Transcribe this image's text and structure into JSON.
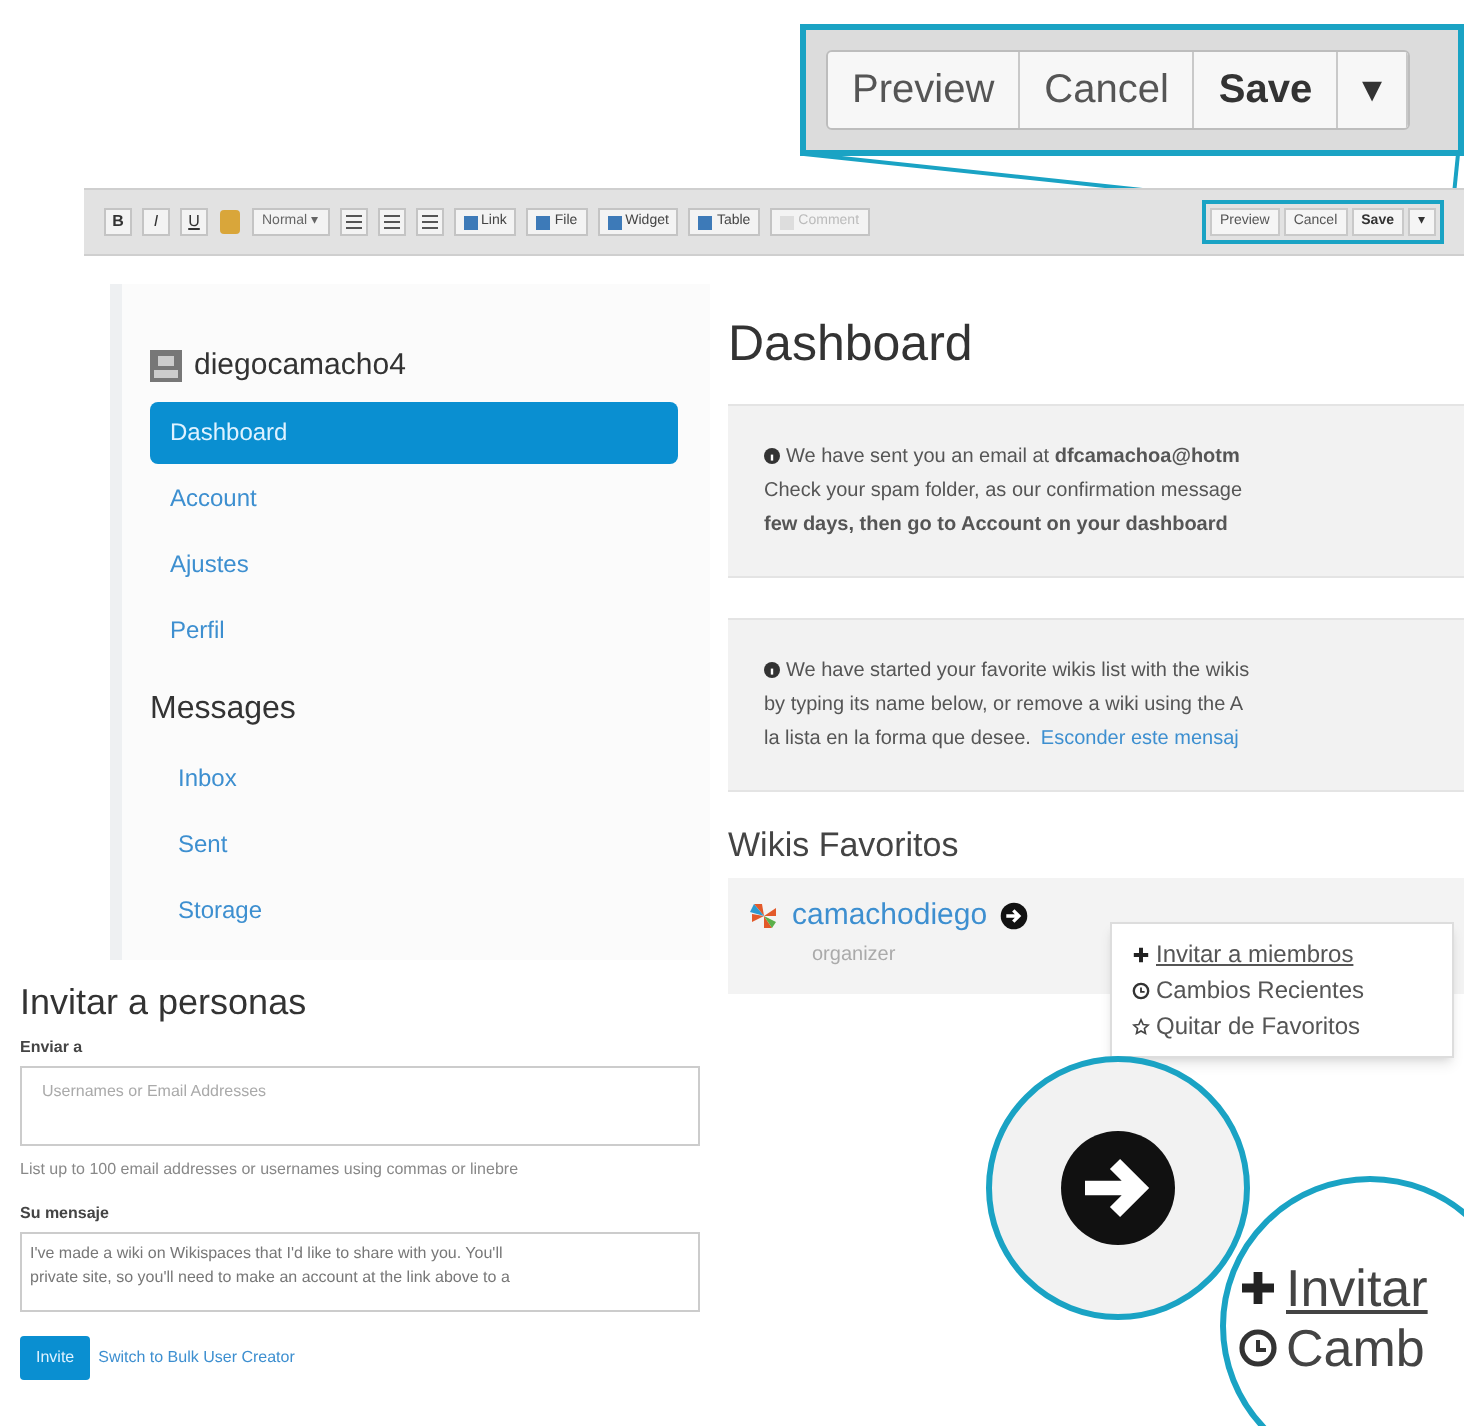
{
  "callout_buttons": [
    {
      "label": "Preview",
      "kind": "button"
    },
    {
      "label": "Cancel",
      "kind": "button"
    },
    {
      "label": "Save",
      "kind": "primary"
    },
    {
      "label": "▾",
      "kind": "caret"
    }
  ],
  "toolbar": {
    "format_buttons": [
      "B",
      "I",
      "U"
    ],
    "style_select": "Normal",
    "style_caret": "▾",
    "tools": [
      {
        "label": "Link",
        "disabled": false
      },
      {
        "label": "File",
        "disabled": false
      },
      {
        "label": "Widget",
        "disabled": false
      },
      {
        "label": "Table",
        "disabled": false
      },
      {
        "label": "Comment",
        "disabled": true
      }
    ],
    "actions": [
      {
        "label": "Preview",
        "kind": "button"
      },
      {
        "label": "Cancel",
        "kind": "button"
      },
      {
        "label": "Save",
        "kind": "primary"
      },
      {
        "label": "▾",
        "kind": "caret"
      }
    ]
  },
  "sidebar": {
    "user": "diegocamacho4",
    "items": [
      {
        "label": "Dashboard",
        "selected": true
      },
      {
        "label": "Account",
        "selected": false
      },
      {
        "label": "Ajustes",
        "selected": false
      },
      {
        "label": "Perfil",
        "selected": false
      }
    ],
    "messages_heading": "Messages",
    "message_items": [
      {
        "label": "Inbox",
        "selected": false
      },
      {
        "label": "Sent",
        "selected": false
      },
      {
        "label": "Storage",
        "selected": false
      }
    ]
  },
  "main": {
    "title": "Dashboard",
    "alerts": [
      {
        "lines": [
          "We have sent you an email at **dfcamachoa@hotm**",
          "Check your spam folder, as our confirmation message",
          "**few days, then go to Account on your dashboard**"
        ]
      },
      {
        "lines": [
          "We have started your favorite wikis list with the wikis",
          "by typing its name below, or remove a wiki using the A",
          "la lista en la forma que desee."
        ],
        "link": "Esconder este mensaj"
      }
    ],
    "favorites_heading": "Wikis Favoritos",
    "wiki": {
      "name": "camachodiego",
      "role": "organizer"
    },
    "menu": [
      {
        "label": "Invitar a miembros",
        "kind": "plus"
      },
      {
        "label": "Cambios Recientes",
        "kind": "clock"
      },
      {
        "label": "Quitar de Favoritos",
        "kind": "star"
      }
    ]
  },
  "invite": {
    "title": "Invitar a personas",
    "to_label": "Enviar a",
    "to_placeholder": "Usernames or Email Addresses",
    "hint": "List up to 100 email addresses or usernames using commas or linebre",
    "message_label": "Su mensaje",
    "message_lines": [
      "I've made a wiki on Wikispaces that I'd like to share with you. You'll",
      "private site, so you'll need to make an account at the link above to a"
    ],
    "submit": "Invite",
    "switch_link": "Switch to Bulk User Creator"
  },
  "zoom_menu": [
    {
      "label": "Invitar",
      "kind": "plus"
    },
    {
      "label": "Camb",
      "kind": "clock"
    }
  ]
}
